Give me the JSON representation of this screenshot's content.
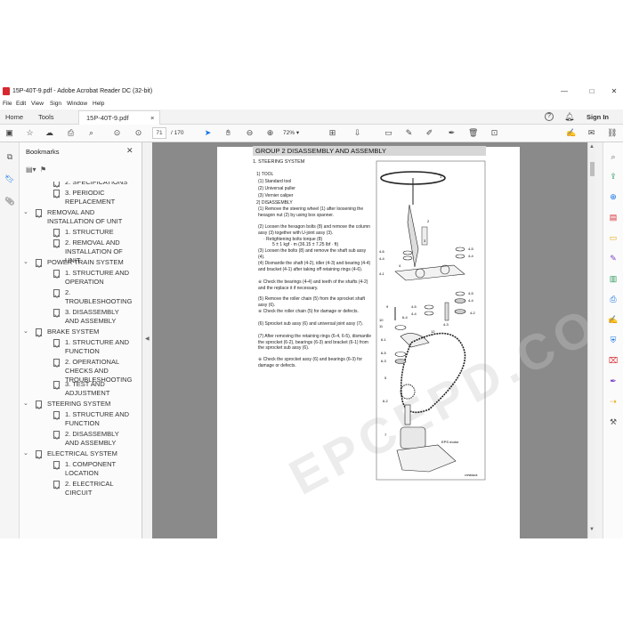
{
  "window": {
    "title": "15P-40T-9.pdf - Adobe Acrobat Reader DC (32-bit)",
    "min": "—",
    "max": "□",
    "close": "✕"
  },
  "menu": [
    "File",
    "Edit",
    "View",
    "Sign",
    "Window",
    "Help"
  ],
  "tabs": {
    "home": "Home",
    "tools": "Tools",
    "document": "15P-40T-9.pdf",
    "doc_close": "×",
    "signin": "Sign In"
  },
  "toolbar": {
    "page_current": "71",
    "page_total": "/ 170",
    "zoom": "72%"
  },
  "bookmarks": {
    "header": "Bookmarks",
    "close": "✕",
    "items": [
      {
        "level": 2,
        "label": "2. SPECIFICATIONS",
        "partial": true
      },
      {
        "level": 2,
        "label": "3. PERIODIC REPLACEMENT"
      },
      {
        "level": 1,
        "label": "REMOVAL AND INSTALLATION OF UNIT",
        "chev": "⌄"
      },
      {
        "level": 2,
        "label": "1. STRUCTURE"
      },
      {
        "level": 2,
        "label": "2. REMOVAL AND INSTALLATION OF UNIT"
      },
      {
        "level": 1,
        "label": "POWER TRAIN SYSTEM",
        "chev": "⌄"
      },
      {
        "level": 2,
        "label": "1. STRUCTURE AND OPERATION"
      },
      {
        "level": 2,
        "label": "2. TROUBLESHOOTING"
      },
      {
        "level": 2,
        "label": "3. DISASSEMBLY AND ASSEMBLY"
      },
      {
        "level": 1,
        "label": "BRAKE SYSTEM",
        "chev": "⌄"
      },
      {
        "level": 2,
        "label": "1. STRUCTURE AND FUNCTION"
      },
      {
        "level": 2,
        "label": "2. OPERATIONAL CHECKS AND TROUBLESHOOTING"
      },
      {
        "level": 2,
        "label": "3. TEST AND ADJUSTMENT"
      },
      {
        "level": 1,
        "label": "STEERING SYSTEM",
        "chev": "⌄"
      },
      {
        "level": 2,
        "label": "1. STRUCTURE AND FUNCTION"
      },
      {
        "level": 2,
        "label": "2. DISASSEMBLY AND ASSEMBLY"
      },
      {
        "level": 1,
        "label": "ELECTRICAL SYSTEM",
        "chev": "⌄"
      },
      {
        "level": 2,
        "label": "1. COMPONENT LOCATION"
      },
      {
        "level": 2,
        "label": "2. ELECTRICAL CIRCUIT"
      }
    ]
  },
  "document": {
    "group_title": "GROUP  2  DISASSEMBLY AND ASSEMBLY",
    "section": "1. STEERING SYSTEM",
    "lines": [
      "1) TOOL",
      "(1) Standard tool",
      "(2) Universal puller",
      "(3) Vernier caliper",
      "2) DISASSEMBLY",
      "(1) Remove the steering wheel (1) after loosening the hexagon nut (2) by using box spanner.",
      "(2) Loosen the hexagon bolts (8) and remove the column assy (3) together with U-joint assy (3).",
      "· Retightening bolts torque (8)",
      "5 ± 1 kgf · m (36.15 ± 7.25 lbf · ft)",
      "(3) Loosen the bolts (8) and remove the shaft sub assy (4).",
      "(4) Dismantle the shaft (4-2), idler (4-3) and bearing (4-4) and bracket (4-1) after taking off retaining rings (4-6).",
      "※ Check the bearings (4-4) and teeth of the shafts (4-2) and the replace it if necessary.",
      "(5) Remove the roller chain (5) from the sprocket shaft assy (6).",
      "※ Check the roller chain (5) for damage or defects.",
      "(6) Sprocket sub assy (6) and universal joint assy (7).",
      "(7) After removing the retaining rings (6-4, 6-5), dismantle the sprocket (6-2), bearings (6-3) and bracket (6-1) from the sprocket sub assy (6).",
      "※ Check the sprocket assy (6) and bearings (6-3) for damage or defects."
    ],
    "callouts": {
      "c1": "1",
      "c2": "2",
      "c3": "3",
      "c4": "4",
      "c45": "4-5",
      "c46": "4-6",
      "c44": "4-4",
      "c41": "4-1",
      "c42": "4-2",
      "c43": "4-3",
      "c9": "9",
      "c10": "10",
      "c11": "11",
      "c64": "6-4",
      "c61": "6-1",
      "c5": "5",
      "c62": "6-2",
      "c65": "6-5",
      "c63": "6-3",
      "c7": "7",
      "c12": "12",
      "eps": "EPS motor"
    },
    "footer": "15P9BDE08",
    "watermark": "EPCEPD.COM"
  },
  "icons": {
    "home_color": "#1473e6",
    "accent": "#d7282f"
  }
}
